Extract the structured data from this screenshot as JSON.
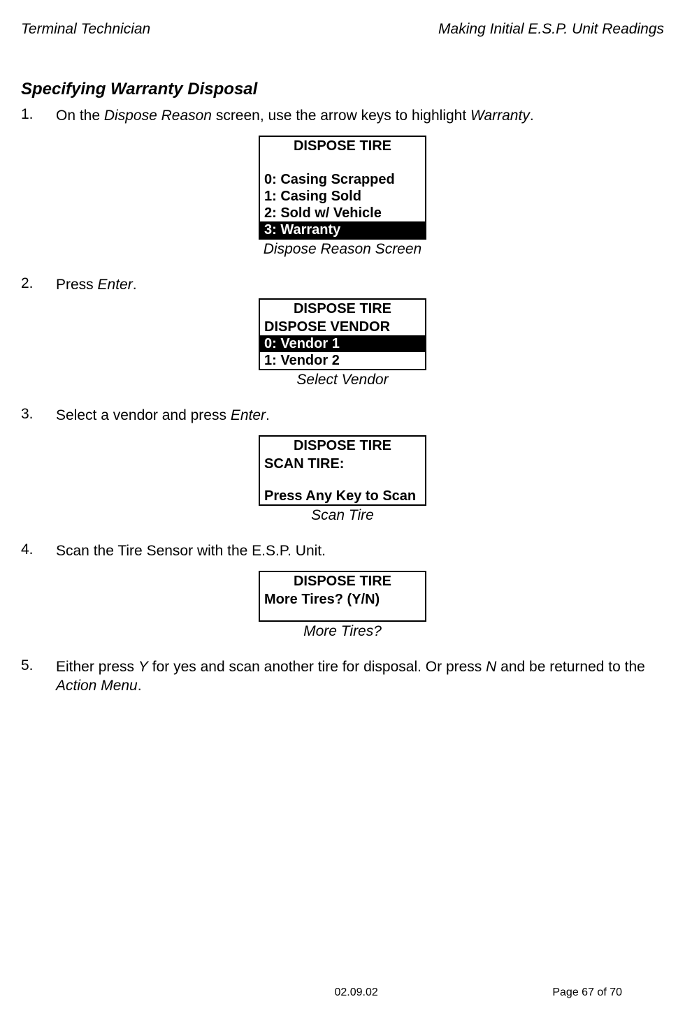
{
  "header": {
    "left": "Terminal Technician",
    "right": "Making Initial E.S.P. Unit Readings"
  },
  "sectionTitle": "Specifying Warranty Disposal",
  "steps": {
    "1": {
      "num": "1.",
      "pre": "On the ",
      "italic1": "Dispose Reason",
      "mid": " screen, use the arrow keys to highlight ",
      "italic2": "Warranty",
      "post": "."
    },
    "2": {
      "num": "2.",
      "pre": "Press ",
      "italic1": "Enter",
      "post": "."
    },
    "3": {
      "num": "3.",
      "pre": "Select a vendor and press ",
      "italic1": "Enter",
      "post": "."
    },
    "4": {
      "num": "4.",
      "text": "Scan the Tire Sensor with the E.S.P. Unit."
    },
    "5": {
      "num": "5.",
      "pre": "Either press ",
      "italic1": "Y",
      "mid1": " for yes and scan another tire for disposal. Or press ",
      "italic2": "N",
      "mid2": " and be returned to the ",
      "italic3": "Action Menu",
      "post": "."
    }
  },
  "screens": {
    "s1": {
      "title": "DISPOSE TIRE",
      "lines": {
        "l0": "0: Casing Scrapped",
        "l1": "1: Casing Sold",
        "l2": "2: Sold w/ Vehicle",
        "l3": "3: Warranty"
      },
      "caption": "Dispose Reason Screen"
    },
    "s2": {
      "title": "DISPOSE TIRE",
      "subtitle": "DISPOSE VENDOR",
      "lines": {
        "l0": "0: Vendor 1",
        "l1": "1: Vendor 2"
      },
      "caption": "Select Vendor"
    },
    "s3": {
      "title": "DISPOSE TIRE",
      "line1": "SCAN TIRE:",
      "line2": "Press Any Key to Scan",
      "caption": "Scan Tire"
    },
    "s4": {
      "title": "DISPOSE TIRE",
      "line1": "More Tires?  (Y/N)",
      "caption": "More Tires?"
    }
  },
  "footer": {
    "date": "02.09.02",
    "page": "Page 67 of 70"
  }
}
